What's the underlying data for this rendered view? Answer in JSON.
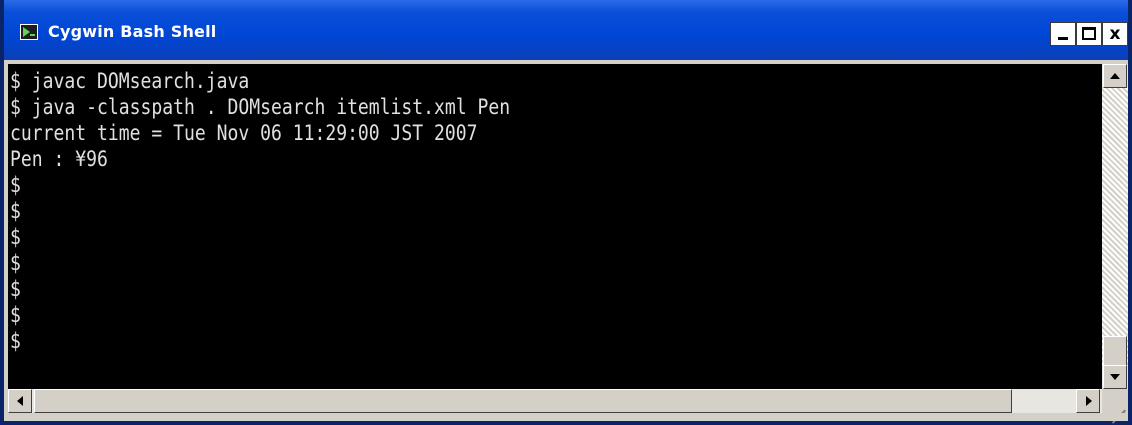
{
  "window": {
    "title": "Cygwin Bash Shell",
    "icon": "cygwin-terminal-icon",
    "controls": {
      "minimize_icon": "minimize-icon",
      "maximize_icon": "maximize-icon",
      "close_label": "x"
    }
  },
  "terminal": {
    "background_color": "#000000",
    "text_color": "#e0e0e0",
    "lines": [
      "$ javac DOMsearch.java",
      "$ java -classpath . DOMsearch itemlist.xml Pen",
      "current time = Tue Nov 06 11:29:00 JST 2007",
      "Pen : ¥96",
      "$",
      "$",
      "$",
      "$",
      "$",
      "$",
      "$"
    ]
  },
  "scrollbars": {
    "vertical_position": 1.0,
    "horizontal_position": 0.0
  },
  "colors": {
    "titlebar": "#0046d5",
    "title_text": "#ffffff",
    "chrome": "#d4d0c8"
  }
}
